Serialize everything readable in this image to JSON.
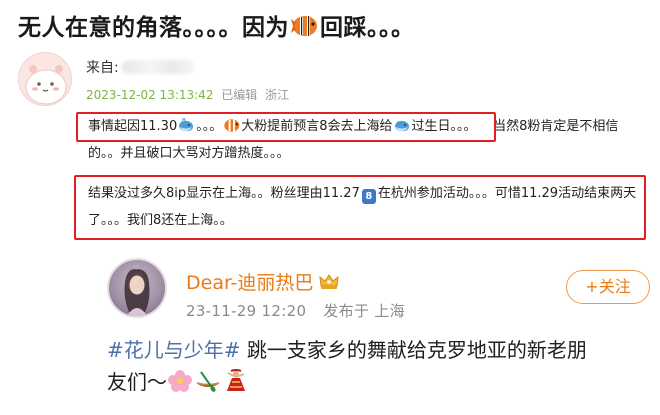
{
  "title": {
    "before": "无人在意的角落。。。。因为",
    "emoji": "fish-emoji",
    "after": "回踩。。。"
  },
  "post": {
    "source_label": "来自:",
    "date": "2023-12-02 13:13:42",
    "edited": "已编辑",
    "location": "浙江"
  },
  "paragraph1": {
    "line1_a": "事情起因11.30",
    "line1_b": "。。。",
    "line1_c": "大粉提前预言8会去上海给",
    "line1_d": "过生日。。。",
    "line1_e": "当然8粉肯定是不相信",
    "line2": "的。。并且破口大骂对方蹭热度。。。"
  },
  "paragraph2": {
    "line1_a": "结果没过多久8ip显示在上海。。粉丝理由11.27",
    "badge": "8",
    "line1_b": "在杭州参加活动。。。可惜11.29活动结束两天",
    "line2": "了。。。我们8还在上海。。"
  },
  "embed": {
    "name": "Dear-迪丽热巴",
    "date": "23-11-29 12:20",
    "publish_label": "发布于 上海",
    "follow_label": "+关注",
    "hashtag": "#花儿与少年#",
    "text1": " 跳一支家乡的舞献给克罗地亚的新老朋",
    "text2": "友们～"
  },
  "colors": {
    "highlight": "#e02020",
    "name_orange": "#ec7a14",
    "hashtag_blue": "#4f6fa8",
    "date_green": "#7fb342"
  },
  "icons": [
    "fish-emoji",
    "whale-emoji",
    "crown-icon",
    "flower-emoji",
    "canoe-emoji",
    "dancer-emoji",
    "number-8-badge"
  ]
}
